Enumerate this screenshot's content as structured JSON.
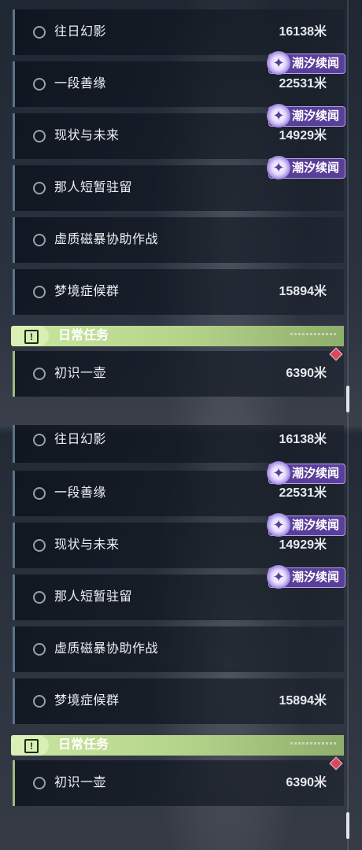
{
  "quests": [
    {
      "name": "往日幻影",
      "distance": "16138米",
      "tag": ""
    },
    {
      "name": "一段善缘",
      "distance": "22531米",
      "tag": "潮汐续闻"
    },
    {
      "name": "现状与未来",
      "distance": "14929米",
      "tag": "潮汐续闻"
    },
    {
      "name": "那人短暂驻留",
      "distance": "",
      "tag": "潮汐续闻"
    },
    {
      "name": "虚质磁暴协助作战",
      "distance": "",
      "tag": ""
    },
    {
      "name": "梦境症候群",
      "distance": "15894米",
      "tag": ""
    }
  ],
  "daily": {
    "title": "日常任务",
    "items": [
      {
        "name": "初识一壶",
        "distance": "6390米"
      }
    ]
  },
  "tag_icon_glyph": "✦",
  "colors": {
    "tag_bg": "#5a3f9a",
    "daily_green": "#c9e6a0",
    "row_accent": "#5b7389",
    "marker_red": "#d44a5c"
  }
}
